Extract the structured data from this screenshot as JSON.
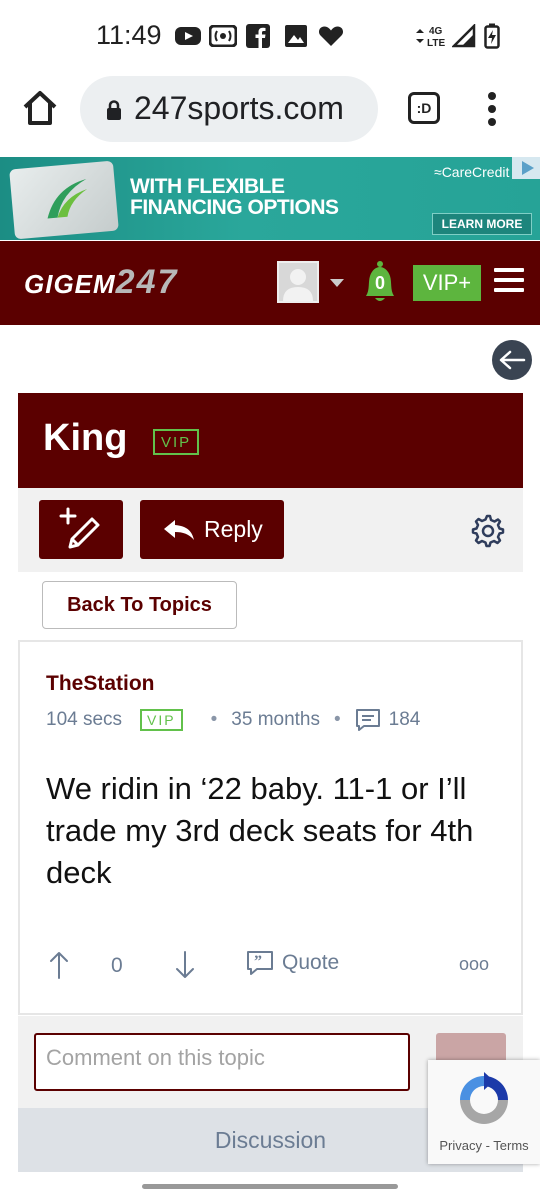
{
  "status_bar": {
    "time": "11:49",
    "left_icons": [
      "youtube-icon",
      "radio-icon",
      "facebook-icon",
      "image-icon",
      "heart-icon"
    ],
    "network": "4G LTE",
    "right_icons": [
      "data-arrows-icon",
      "signal-icon",
      "battery-charging-icon"
    ]
  },
  "browser": {
    "url": "247sports.com",
    "tabs_label": ":D"
  },
  "ad": {
    "headline_line1": "WITH FLEXIBLE",
    "headline_line2": "FINANCING OPTIONS",
    "brand": "CareCredit",
    "cta": "LEARN MORE"
  },
  "header": {
    "logo_text": "GIGEM",
    "logo_number": "247",
    "notification_count": "0",
    "vip_plus_label": "VIP+"
  },
  "board": {
    "title": "King",
    "vip_badge": "VIP",
    "reply_label": "Reply",
    "back_to_topics_label": "Back To Topics"
  },
  "post": {
    "author": "TheStation",
    "time_ago": "104 secs",
    "vip_badge": "VIP",
    "member_duration": "35 months",
    "post_count": "184",
    "body": "We ridin in ‘22 baby. 11-1 or I’ll trade my 3rd deck seats for 4th deck",
    "vote_count": "0",
    "quote_label": "Quote",
    "more_label": "ooo"
  },
  "comment": {
    "placeholder": "Comment on this topic"
  },
  "tabs": {
    "discussion_label": "Discussion"
  },
  "recaptcha": {
    "privacy_label": "Privacy",
    "separator": " - ",
    "terms_label": "Terms"
  },
  "colors": {
    "maroon": "#5b0000",
    "vip_green": "#62c14b",
    "vip_plus_green": "#5db53e",
    "meta_gray": "#6b7c93",
    "ad_teal": "#2aa79b"
  }
}
